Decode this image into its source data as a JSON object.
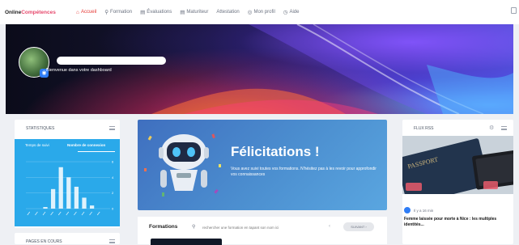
{
  "app": {
    "logo_main": "Online",
    "logo_accent": "Compétences"
  },
  "nav": {
    "items": [
      {
        "label": "Accueil",
        "icon": "home-icon",
        "active": true
      },
      {
        "label": "Formation",
        "icon": "search-icon",
        "active": false
      },
      {
        "label": "Évaluations",
        "icon": "clipboard-icon",
        "active": false
      },
      {
        "label": "Maturiteur",
        "icon": "document-icon",
        "active": false
      },
      {
        "label": "Attestation",
        "icon": "",
        "active": false
      },
      {
        "label": "Mon profil",
        "icon": "user-icon",
        "active": false
      },
      {
        "label": "Aide",
        "icon": "help-icon",
        "active": false
      }
    ]
  },
  "banner": {
    "welcome": "Bienvenue dans votre dashboard"
  },
  "stats": {
    "title": "STATISTIQUES",
    "tab_1": "Temps de suivi",
    "tab_2": "Nombre de connexion",
    "chart_data": {
      "type": "bar",
      "categories": [
        "",
        "",
        "",
        "",
        "",
        "",
        "",
        "",
        "",
        ""
      ],
      "values": [
        0,
        0,
        0.2,
        2.5,
        5.3,
        4,
        2.8,
        1.4,
        0.4,
        0
      ],
      "ylim": [
        0,
        6
      ],
      "yticks": [
        "6",
        "4",
        "2",
        "0"
      ]
    }
  },
  "pages": {
    "title": "PAGES EN COURS"
  },
  "congrats": {
    "title": "Félicitations !",
    "text": "Vous avez suivi toutes vos formations. N'hésitez pas à les revoir pour approfondir vos connaissances"
  },
  "formations": {
    "title": "Formations",
    "search_placeholder": "rechercher une formation en tapant son nom ici",
    "prev": "‹",
    "next": "SUIVANT ›"
  },
  "rss": {
    "title": "FLUX RSS",
    "image_label": "PASSPORT",
    "time": "Il y a 16 min",
    "headline": "Femme laissée pour morte à Nice : les multiples identités..."
  },
  "colors": {
    "accent": "#e53935",
    "brand": "#e64a6d",
    "stats_panel": "#2aa9ea",
    "congrats_panel": "#4c8fd0"
  }
}
